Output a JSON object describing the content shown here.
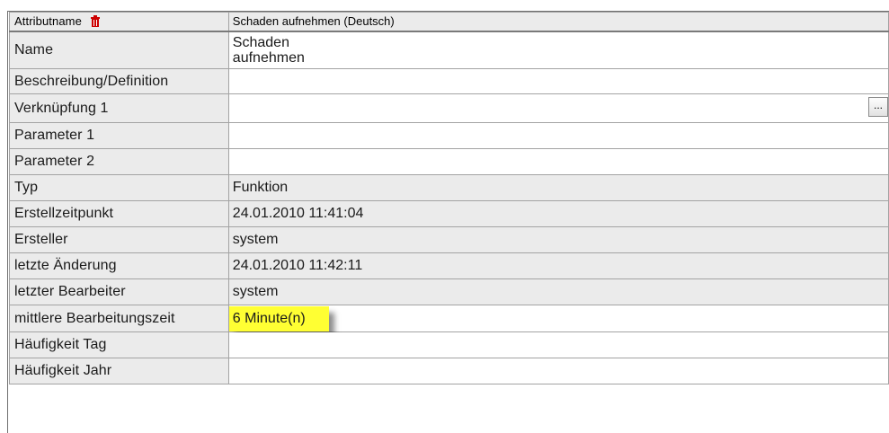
{
  "header": {
    "label": "Attributname",
    "value": "Schaden aufnehmen (Deutsch)"
  },
  "rows": [
    {
      "label": "Name",
      "value_line1": "Schaden",
      "value_line2": "aufnehmen"
    },
    {
      "label": "Beschreibung/Definition",
      "value": ""
    },
    {
      "label": "Verknüpfung 1",
      "value": "",
      "button_label": "..."
    },
    {
      "label": "Parameter 1",
      "value": ""
    },
    {
      "label": "Parameter 2",
      "value": ""
    },
    {
      "label": "Typ",
      "value": "Funktion"
    },
    {
      "label": "Erstellzeitpunkt",
      "value": "24.01.2010 11:41:04"
    },
    {
      "label": "Ersteller",
      "value": "system"
    },
    {
      "label": "letzte Änderung",
      "value": "24.01.2010 11:42:11"
    },
    {
      "label": "letzter Bearbeiter",
      "value": "system"
    },
    {
      "label": "mittlere Bearbeitungszeit",
      "value": "6  Minute(n)"
    },
    {
      "label": "Häufigkeit Tag",
      "value": ""
    },
    {
      "label": "Häufigkeit Jahr",
      "value": ""
    }
  ],
  "icons": {
    "header_icon": "trash-icon"
  },
  "colors": {
    "highlight": "#ffff33",
    "icon_red": "#cc0000",
    "label_bg": "#ebebeb"
  }
}
